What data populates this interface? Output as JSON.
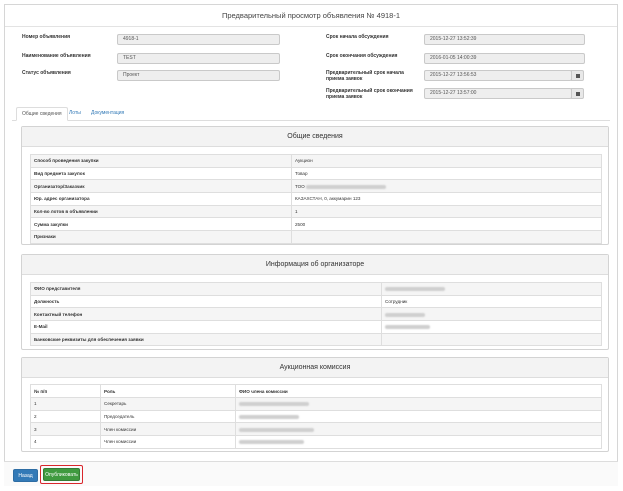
{
  "title": "Предварительный просмотр объявления № 4918-1",
  "form": {
    "left": [
      {
        "label": "Номер объявления",
        "value": "4918-1"
      },
      {
        "label": "Наименование объявления",
        "value": "TEST"
      },
      {
        "label": "Статус объявления",
        "value": "Проект"
      }
    ],
    "right": [
      {
        "label": "Срок начала обсуждения",
        "value": "2015-12-27 13:52:39"
      },
      {
        "label": "Срок окончания обсуждения",
        "value": "2016-01-05 14:00:39"
      },
      {
        "label": "Предварительный срок начала приема заявок",
        "value": "2015-12-27 13:56:53"
      },
      {
        "label": "Предварительный срок окончания приема заявок",
        "value": "2015-12-27 13:57:00"
      }
    ]
  },
  "tabs": [
    "Общие сведения",
    "Лоты",
    "Документация"
  ],
  "general": {
    "title": "Общие сведения",
    "rows": [
      {
        "key": "Способ проведения закупки",
        "value": "Аукцион"
      },
      {
        "key": "Вид предмета закупок",
        "value": "Товар"
      },
      {
        "key": "Организатор/Заказчик",
        "value": "ТОО"
      },
      {
        "key": "Юр. адрес организатора",
        "value": "КАЗАХСТАН, 0, аккумарин 123"
      },
      {
        "key": "Кол-во лотов в объявлении",
        "value": "1"
      },
      {
        "key": "Сумма закупки",
        "value": "2500"
      },
      {
        "key": "Признаки",
        "value": ""
      }
    ]
  },
  "organizer": {
    "title": "Информация об организаторе",
    "rows": [
      {
        "key": "ФИО представителя",
        "value": ""
      },
      {
        "key": "Должность",
        "value": "Сотрудник"
      },
      {
        "key": "Контактный телефон",
        "value": ""
      },
      {
        "key": "E-Mail",
        "value": ""
      },
      {
        "key": "Банковские реквизиты для обеспечения заявки",
        "value": ""
      }
    ]
  },
  "commission": {
    "title": "Аукционная комиссия",
    "columns": [
      "№ п/п",
      "Роль",
      "ФИО члена комиссии"
    ],
    "rows": [
      {
        "num": "1",
        "role": "Секретарь"
      },
      {
        "num": "2",
        "role": "Председатель"
      },
      {
        "num": "3",
        "role": "Член комиссии"
      },
      {
        "num": "4",
        "role": "Член комиссии"
      }
    ]
  },
  "buttons": {
    "back": "Назад",
    "publish": "Опубликовать"
  },
  "colors": {
    "primary": "#337ab7",
    "success": "#3f9a3f",
    "highlight": "#d9262c",
    "link": "#337ab7"
  },
  "icons": {
    "date_picker": "calendar-icon"
  }
}
